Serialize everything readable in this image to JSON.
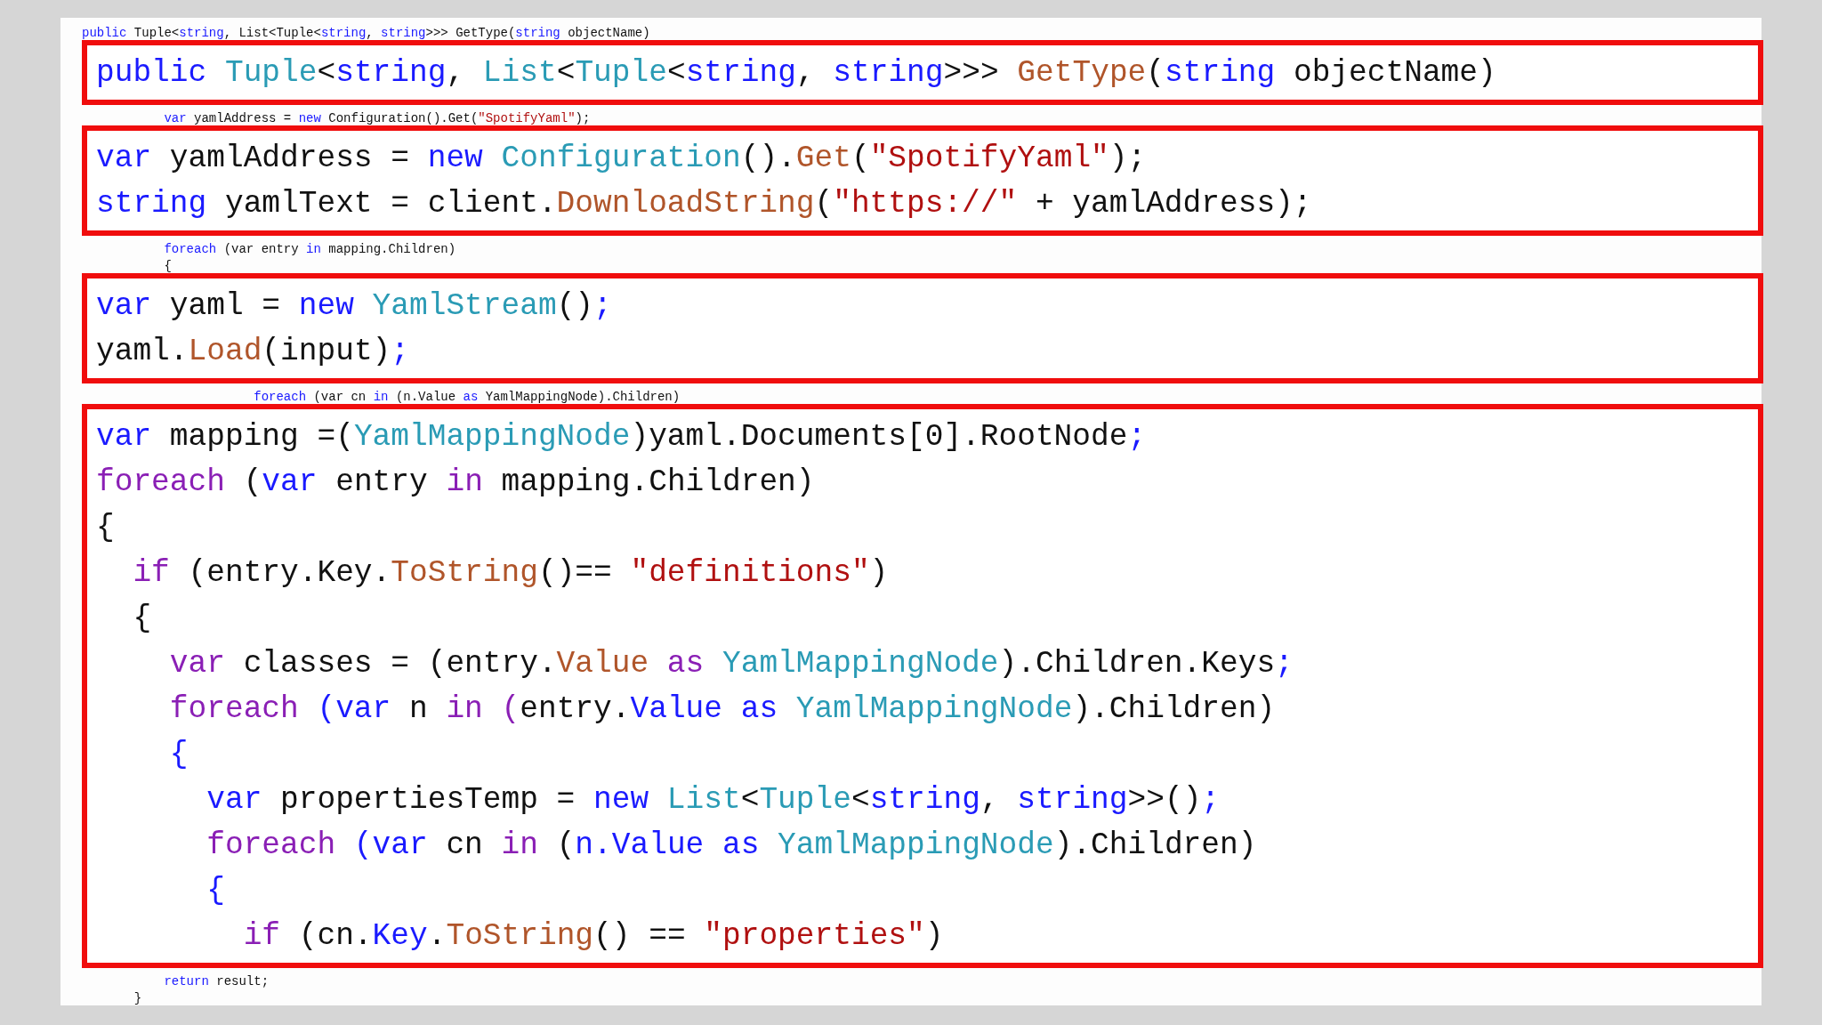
{
  "sections": [
    {
      "kind": "line",
      "tokens": [
        {
          "kind": "kw",
          "text": "public"
        },
        {
          "kind": "plain",
          "text": " Tuple<"
        },
        {
          "kind": "kw",
          "text": "string"
        },
        {
          "kind": "plain",
          "text": ", List<Tuple<"
        },
        {
          "kind": "kw",
          "text": "string"
        },
        {
          "kind": "plain",
          "text": ", "
        },
        {
          "kind": "kw",
          "text": "string"
        },
        {
          "kind": "plain",
          "text": ">>> GetType("
        },
        {
          "kind": "kw",
          "text": "string"
        },
        {
          "kind": "plain",
          "text": " objectName)"
        }
      ]
    },
    {
      "kind": "highlight",
      "lines": [
        {
          "tokens": [
            {
              "kind": "kw",
              "text": "public "
            },
            {
              "kind": "type",
              "text": "Tuple"
            },
            {
              "kind": "plain",
              "text": "<"
            },
            {
              "kind": "kw",
              "text": "string"
            },
            {
              "kind": "plain",
              "text": ", "
            },
            {
              "kind": "type",
              "text": "List"
            },
            {
              "kind": "plain",
              "text": "<"
            },
            {
              "kind": "type",
              "text": "Tuple"
            },
            {
              "kind": "plain",
              "text": "<"
            },
            {
              "kind": "kw",
              "text": "string"
            },
            {
              "kind": "plain",
              "text": ", "
            },
            {
              "kind": "kw",
              "text": "string"
            },
            {
              "kind": "plain",
              "text": ">>> "
            },
            {
              "kind": "method",
              "text": "GetType"
            },
            {
              "kind": "plain",
              "text": "("
            },
            {
              "kind": "kw",
              "text": "string"
            },
            {
              "kind": "plain",
              "text": " objectName)"
            }
          ]
        }
      ]
    },
    {
      "kind": "line",
      "tokens": [
        {
          "kind": "kw",
          "text": "           var"
        },
        {
          "kind": "plain",
          "text": " yamlAddress = "
        },
        {
          "kind": "kw",
          "text": "new"
        },
        {
          "kind": "plain",
          "text": " Configuration().Get("
        },
        {
          "kind": "str",
          "text": "\"SpotifyYaml\""
        },
        {
          "kind": "plain",
          "text": ");"
        }
      ]
    },
    {
      "kind": "highlight",
      "lines": [
        {
          "tokens": [
            {
              "kind": "kw",
              "text": "var"
            },
            {
              "kind": "plain",
              "text": " yamlAddress = "
            },
            {
              "kind": "kw",
              "text": "new "
            },
            {
              "kind": "type",
              "text": "Configuration"
            },
            {
              "kind": "plain",
              "text": "()."
            },
            {
              "kind": "method",
              "text": "Get"
            },
            {
              "kind": "plain",
              "text": "("
            },
            {
              "kind": "str",
              "text": "\"SpotifyYaml\""
            },
            {
              "kind": "plain",
              "text": ");"
            }
          ]
        },
        {
          "tokens": [
            {
              "kind": "kw",
              "text": "string"
            },
            {
              "kind": "plain",
              "text": " yamlText = client."
            },
            {
              "kind": "method",
              "text": "DownloadString"
            },
            {
              "kind": "plain",
              "text": "("
            },
            {
              "kind": "str",
              "text": "\"https://\""
            },
            {
              "kind": "plain",
              "text": " + yamlAddress);"
            }
          ]
        }
      ]
    },
    {
      "kind": "line",
      "tokens": [
        {
          "kind": "kw",
          "text": "           foreach"
        },
        {
          "kind": "plain",
          "text": " (var entry "
        },
        {
          "kind": "kw",
          "text": "in"
        },
        {
          "kind": "plain",
          "text": " mapping.Children)"
        }
      ]
    },
    {
      "kind": "line",
      "tokens": [
        {
          "kind": "plain",
          "text": "           {"
        }
      ]
    },
    {
      "kind": "highlight",
      "lines": [
        {
          "tokens": [
            {
              "kind": "kw",
              "text": "var"
            },
            {
              "kind": "plain",
              "text": " yaml = "
            },
            {
              "kind": "kw",
              "text": "new "
            },
            {
              "kind": "type",
              "text": "YamlStream"
            },
            {
              "kind": "plain",
              "text": "()"
            },
            {
              "kind": "kw",
              "text": ";"
            }
          ]
        },
        {
          "tokens": [
            {
              "kind": "plain",
              "text": "yaml."
            },
            {
              "kind": "method",
              "text": "Load"
            },
            {
              "kind": "plain",
              "text": "(input)"
            },
            {
              "kind": "kw",
              "text": ";"
            }
          ]
        }
      ]
    },
    {
      "kind": "line",
      "tokens": [
        {
          "kind": "kw",
          "text": "                       foreach"
        },
        {
          "kind": "plain",
          "text": " (var cn "
        },
        {
          "kind": "kw",
          "text": "in"
        },
        {
          "kind": "plain",
          "text": " (n.Value "
        },
        {
          "kind": "kw",
          "text": "as"
        },
        {
          "kind": "plain",
          "text": " YamlMappingNode).Children)"
        }
      ]
    },
    {
      "kind": "highlight",
      "lines": [
        {
          "tokens": [
            {
              "kind": "kw",
              "text": "var"
            },
            {
              "kind": "plain",
              "text": " mapping =("
            },
            {
              "kind": "type",
              "text": "YamlMappingNode"
            },
            {
              "kind": "plain",
              "text": ")yaml.Documents[0].RootNode"
            },
            {
              "kind": "kw",
              "text": ";"
            }
          ]
        },
        {
          "tokens": [
            {
              "kind": "ctl",
              "text": "foreach"
            },
            {
              "kind": "plain",
              "text": " ("
            },
            {
              "kind": "kw",
              "text": "var"
            },
            {
              "kind": "plain",
              "text": " entry "
            },
            {
              "kind": "ctl",
              "text": "in"
            },
            {
              "kind": "plain",
              "text": " mapping.Children)"
            }
          ]
        },
        {
          "tokens": [
            {
              "kind": "plain",
              "text": "{"
            }
          ]
        },
        {
          "tokens": [
            {
              "kind": "ctl",
              "text": "  if"
            },
            {
              "kind": "plain",
              "text": " (entry.Key."
            },
            {
              "kind": "method",
              "text": "ToString"
            },
            {
              "kind": "plain",
              "text": "()== "
            },
            {
              "kind": "str",
              "text": "\"definitions\""
            },
            {
              "kind": "plain",
              "text": ")"
            }
          ]
        },
        {
          "tokens": [
            {
              "kind": "plain",
              "text": "  {"
            }
          ]
        },
        {
          "tokens": [
            {
              "kind": "ctl",
              "text": "    var"
            },
            {
              "kind": "plain",
              "text": " classes = (entry."
            },
            {
              "kind": "method",
              "text": "Value"
            },
            {
              "kind": "ctl",
              "text": " as "
            },
            {
              "kind": "type",
              "text": "YamlMappingNode"
            },
            {
              "kind": "plain",
              "text": ").Children.Keys"
            },
            {
              "kind": "kw",
              "text": ";"
            }
          ]
        },
        {
          "tokens": [
            {
              "kind": "ctl",
              "text": "    foreach "
            },
            {
              "kind": "kw",
              "text": "(var"
            },
            {
              "kind": "plain",
              "text": " n "
            },
            {
              "kind": "ctl",
              "text": "in ("
            },
            {
              "kind": "plain",
              "text": "entry."
            },
            {
              "kind": "kw",
              "text": "Value as "
            },
            {
              "kind": "type",
              "text": "YamlMappingNode"
            },
            {
              "kind": "plain",
              "text": ").Children)"
            }
          ]
        },
        {
          "tokens": [
            {
              "kind": "kw",
              "text": "    {"
            }
          ]
        },
        {
          "tokens": [
            {
              "kind": "kw",
              "text": "      var"
            },
            {
              "kind": "plain",
              "text": " propertiesTemp = "
            },
            {
              "kind": "kw",
              "text": "new "
            },
            {
              "kind": "type",
              "text": "List"
            },
            {
              "kind": "plain",
              "text": "<"
            },
            {
              "kind": "type",
              "text": "Tuple"
            },
            {
              "kind": "plain",
              "text": "<"
            },
            {
              "kind": "kw",
              "text": "string"
            },
            {
              "kind": "plain",
              "text": ", "
            },
            {
              "kind": "kw",
              "text": "string"
            },
            {
              "kind": "plain",
              "text": ">>()"
            },
            {
              "kind": "kw",
              "text": ";"
            }
          ]
        },
        {
          "tokens": [
            {
              "kind": "ctl",
              "text": "      foreach "
            },
            {
              "kind": "kw",
              "text": "(var"
            },
            {
              "kind": "plain",
              "text": " cn "
            },
            {
              "kind": "ctl",
              "text": "in"
            },
            {
              "kind": "plain",
              "text": " ("
            },
            {
              "kind": "kw",
              "text": "n.Value as "
            },
            {
              "kind": "type",
              "text": "YamlMappingNode"
            },
            {
              "kind": "plain",
              "text": ").Children)"
            }
          ]
        },
        {
          "tokens": [
            {
              "kind": "kw",
              "text": "      {"
            }
          ]
        },
        {
          "tokens": [
            {
              "kind": "ctl",
              "text": "        if"
            },
            {
              "kind": "plain",
              "text": " (cn."
            },
            {
              "kind": "kw",
              "text": "Key"
            },
            {
              "kind": "plain",
              "text": "."
            },
            {
              "kind": "method",
              "text": "ToString"
            },
            {
              "kind": "plain",
              "text": "() == "
            },
            {
              "kind": "str",
              "text": "\"properties\""
            },
            {
              "kind": "plain",
              "text": ")"
            }
          ]
        }
      ]
    },
    {
      "kind": "line",
      "tokens": [
        {
          "kind": "kw",
          "text": "           return"
        },
        {
          "kind": "plain",
          "text": " result;"
        }
      ]
    },
    {
      "kind": "line",
      "tokens": [
        {
          "kind": "plain",
          "text": "       }"
        }
      ]
    }
  ]
}
